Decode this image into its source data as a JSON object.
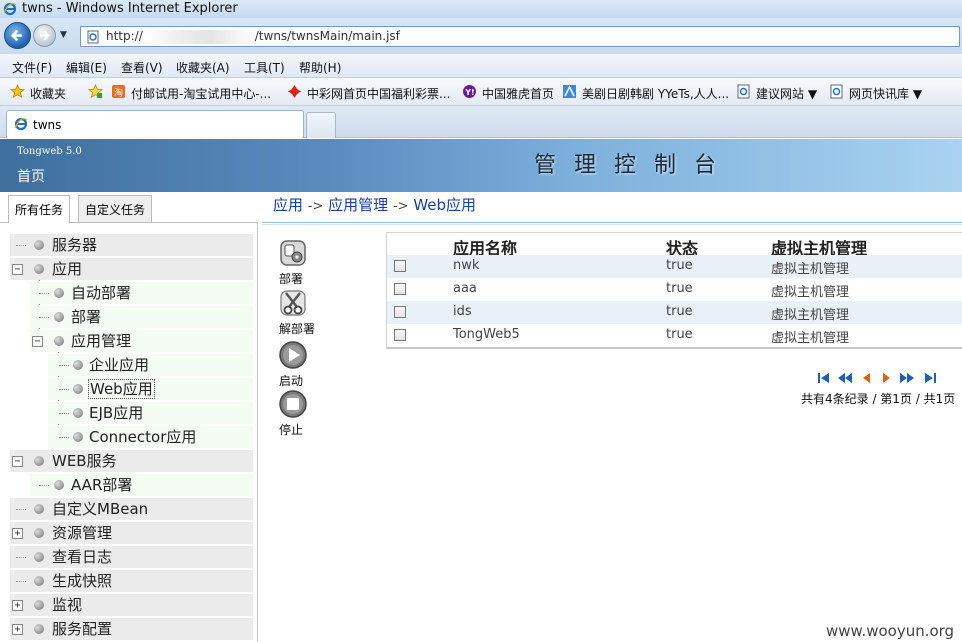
{
  "window": {
    "title": "twns - Windows Internet Explorer",
    "url": "http://",
    "url_suffix": "/twns/twnsMain/main.jsf"
  },
  "menu": [
    "文件(F)",
    "编辑(E)",
    "查看(V)",
    "收藏夹(A)",
    "工具(T)",
    "帮助(H)"
  ],
  "favorites": {
    "label": "收藏夹",
    "items": [
      "付邮试用-淘宝试用中心-...",
      "中彩网首页中国福利彩票...",
      "中国雅虎首页",
      "美剧日剧韩剧 YYeTs,人人...",
      "建议网站 ▼",
      "网页快讯库 ▼"
    ]
  },
  "tab": {
    "label": "twns"
  },
  "header": {
    "product": "Tongweb 5.0",
    "home": "首页",
    "console_title": "管理控制台"
  },
  "left_tabs": [
    "所有任务",
    "自定义任务"
  ],
  "tree": {
    "server": "服务器",
    "app": "应用",
    "auto_deploy": "自动部署",
    "deploy": "部署",
    "app_mgmt": "应用管理",
    "enterprise_app": "企业应用",
    "web_app": "Web应用",
    "ejb_app": "EJB应用",
    "connector_app": "Connector应用",
    "web_service": "WEB服务",
    "aar_deploy": "AAR部署",
    "custom_mbean": "自定义MBean",
    "resource_mgmt": "资源管理",
    "view_log": "查看日志",
    "snapshot": "生成快照",
    "monitor": "监视",
    "service_config": "服务配置"
  },
  "breadcrumb": {
    "a": "应用",
    "b": "应用管理",
    "c": "Web应用",
    "sep": "->"
  },
  "actions": {
    "deploy": "部署",
    "undeploy": "解部署",
    "start": "启动",
    "stop": "停止"
  },
  "table": {
    "headers": [
      "应用名称",
      "状态",
      "虚拟主机管理"
    ],
    "rows": [
      {
        "name": "nwk",
        "status": "true",
        "vhost": "虚拟主机管理"
      },
      {
        "name": "aaa",
        "status": "true",
        "vhost": "虚拟主机管理"
      },
      {
        "name": "ids",
        "status": "true",
        "vhost": "虚拟主机管理"
      },
      {
        "name": "TongWeb5",
        "status": "true",
        "vhost": "虚拟主机管理"
      }
    ]
  },
  "pager": {
    "summary": "共有4条纪录 / 第1页 / 共1页"
  },
  "watermark": "www.wooyun.org",
  "colors": {
    "header_start": "#3e6f9d",
    "header_end": "#a9d3f0",
    "link": "#1a3f9c",
    "row_alt": "#eaf0f8"
  }
}
